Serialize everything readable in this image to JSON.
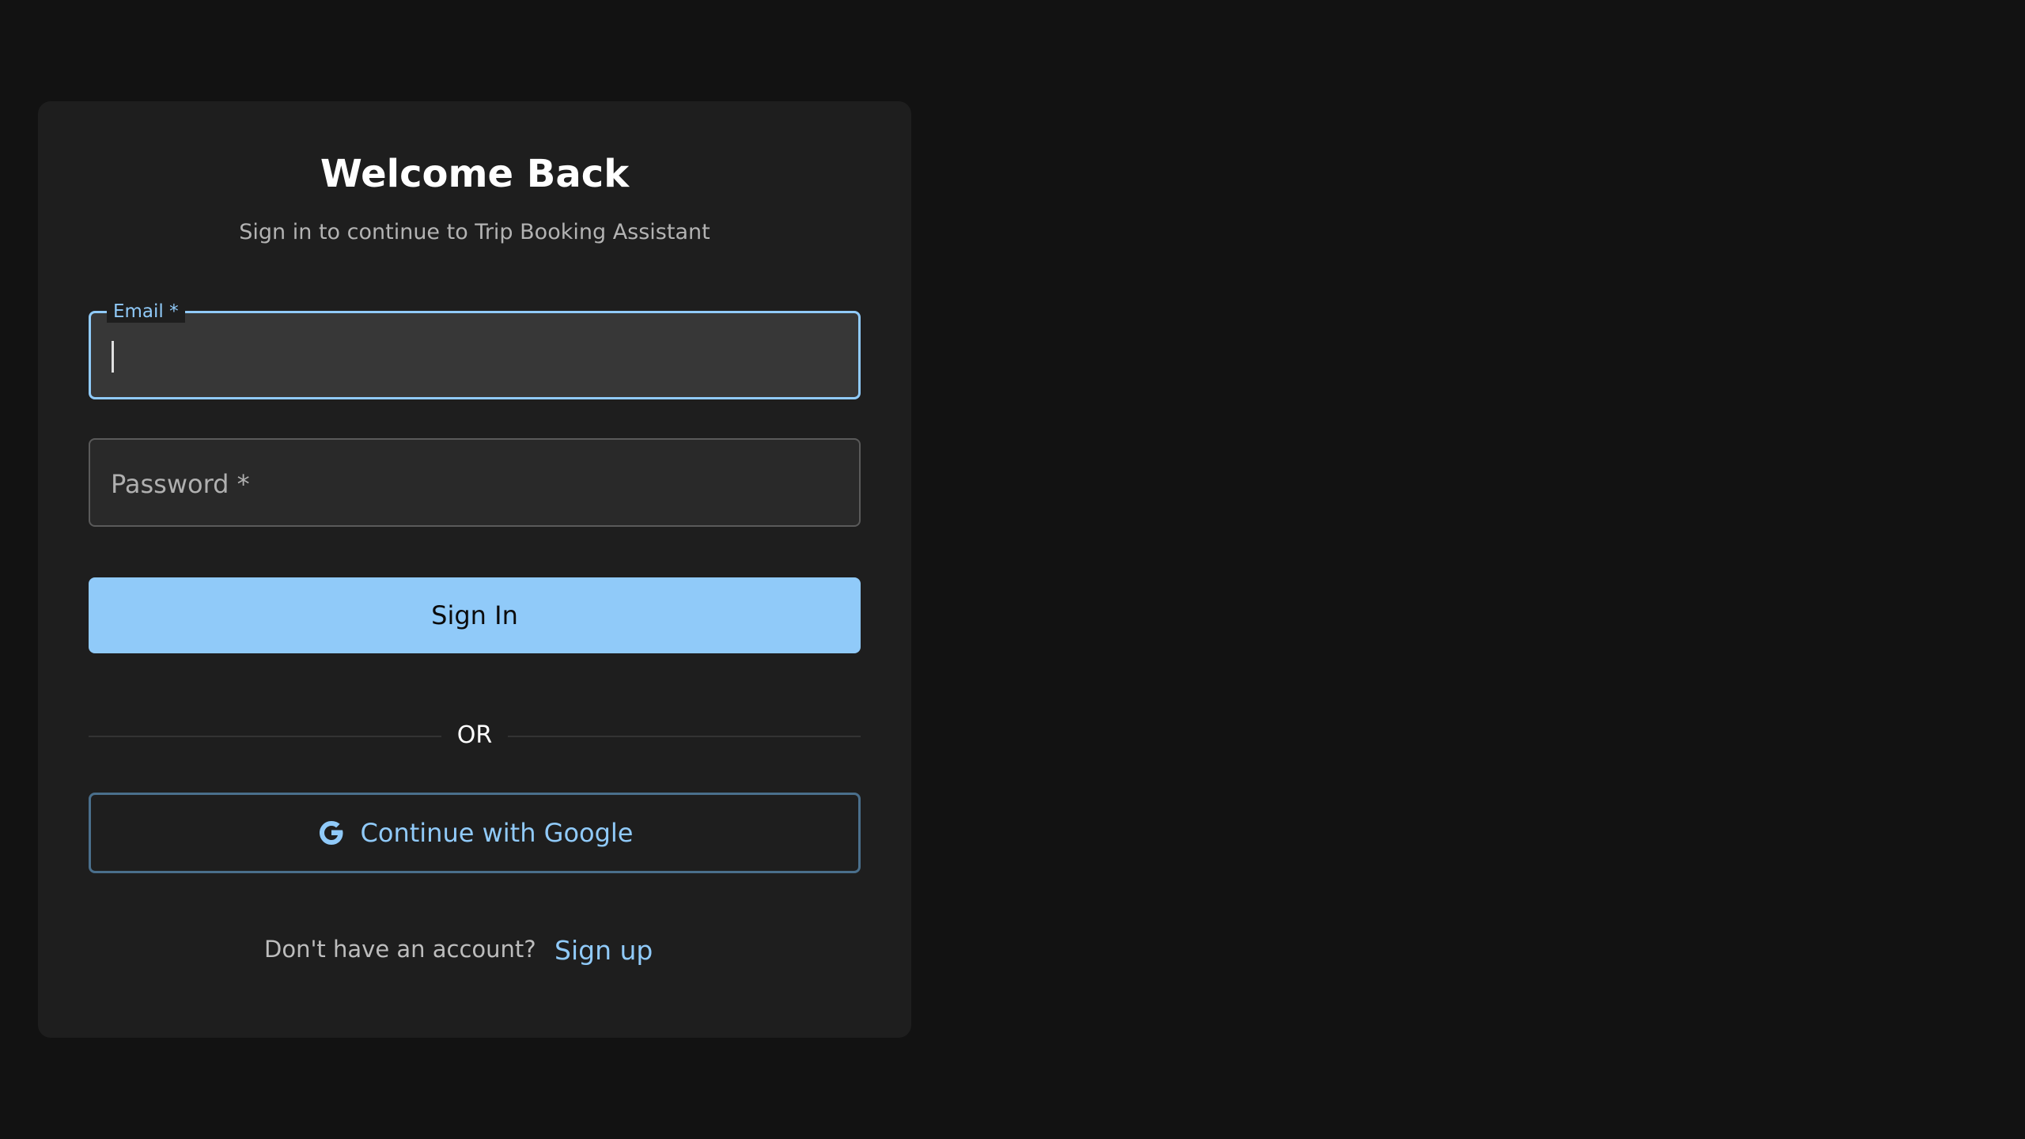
{
  "login": {
    "title": "Welcome Back",
    "subtitle": "Sign in to continue to Trip Booking Assistant",
    "email": {
      "label": "Email *",
      "value": ""
    },
    "password": {
      "label": "Password *",
      "value": ""
    },
    "sign_in_label": "Sign In",
    "divider_text": "OR",
    "google_button_label": "Continue with Google",
    "google_icon": "google-g-icon",
    "signup_prompt": "Don't have an account?",
    "signup_link": "Sign up"
  },
  "colors": {
    "background": "#121212",
    "card": "#1e1e1e",
    "accent": "#90caf9",
    "text_primary": "#ffffff",
    "text_secondary": "#b3b3b3"
  }
}
